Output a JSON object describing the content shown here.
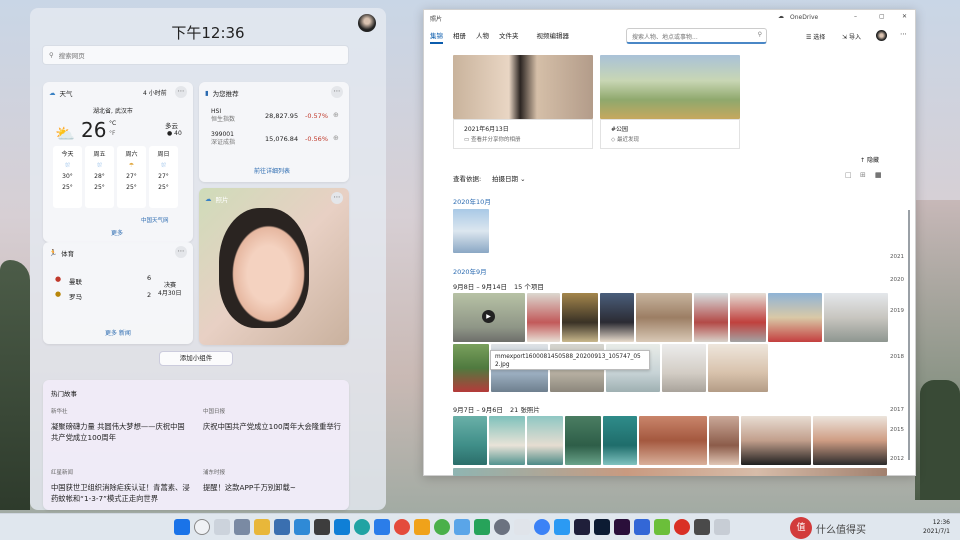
{
  "widgets": {
    "clock": "下午12:36",
    "search_placeholder": "搜索网页",
    "weather": {
      "title": "天气",
      "updated": "4 小时前",
      "location": "湖北省, 武汉市",
      "temp": "26",
      "unit_c": "°C",
      "unit_f": "°F",
      "cond": "多云",
      "aqi": "40",
      "days": [
        {
          "d": "今天",
          "hi": "30°",
          "lo": "25°"
        },
        {
          "d": "周五",
          "hi": "28°",
          "lo": "25°"
        },
        {
          "d": "周六",
          "hi": "27°",
          "lo": "25°"
        },
        {
          "d": "周日",
          "hi": "27°",
          "lo": "25°"
        }
      ],
      "more": "更多",
      "source": "中国天气网"
    },
    "stocks": {
      "title": "为您推荐",
      "rows": [
        {
          "code": "HSI",
          "name": "恒生指数",
          "price": "28,827.95",
          "change": "-0.57%"
        },
        {
          "code": "399001",
          "name": "深证成指",
          "price": "15,076.84",
          "change": "-0.56%"
        }
      ],
      "more": "前往详细列表"
    },
    "photos_title": "照片",
    "sports": {
      "title": "体育",
      "team1": "曼联",
      "team2": "罗马",
      "score1": "6",
      "score2": "2",
      "status": "决赛",
      "date": "4月30日",
      "more": "更多 新闻"
    },
    "add_button": "添加小组件",
    "news": {
      "title": "热门故事",
      "items": [
        {
          "source": "新华社",
          "headline": "凝聚磅礴力量 共圆伟大梦想——庆祝中国共产党成立100周年"
        },
        {
          "source": "中国日报",
          "headline": "庆祝中国共产党成立100周年大会隆重举行"
        },
        {
          "source": "红星新闻",
          "headline": "中国获世卫组织消除疟疾认证！青蒿素、浸药蚊帐和“1-3-7”模式正走向世界"
        },
        {
          "source": "浦东时报",
          "headline": "提醒！这款APP千万别卸载~"
        }
      ]
    }
  },
  "photos_app": {
    "title": "照片",
    "onedrive": "OneDrive",
    "nav": [
      "集锦",
      "相册",
      "人物",
      "文件夹",
      "视频编辑器"
    ],
    "search_placeholder": "搜索人物、地点或事物...",
    "select": "选择",
    "import": "导入",
    "album1_date": "2021年6月13日",
    "album1_sub": "查看并分享你的相册",
    "album2_title": "#公园",
    "album2_sub": "最近发现",
    "hide": "隐藏",
    "view_by": "查看依据:",
    "view_sort": "拍摄日期",
    "month1": "2020年10月",
    "month2": "2020年9月",
    "range1": "9月8日 – 9月14日",
    "range1_count": "15 个项目",
    "tooltip": "mmexport1600081450588_20200913_105747_052.jpg",
    "range2": "9月7日 – 9月6日",
    "range2_count": "21 张照片",
    "years": [
      "2021",
      "2020",
      "2019",
      "2018",
      "2017",
      "2015",
      "2012"
    ]
  },
  "taskbar": {
    "time": "12:36",
    "date": "2021/7/1"
  }
}
